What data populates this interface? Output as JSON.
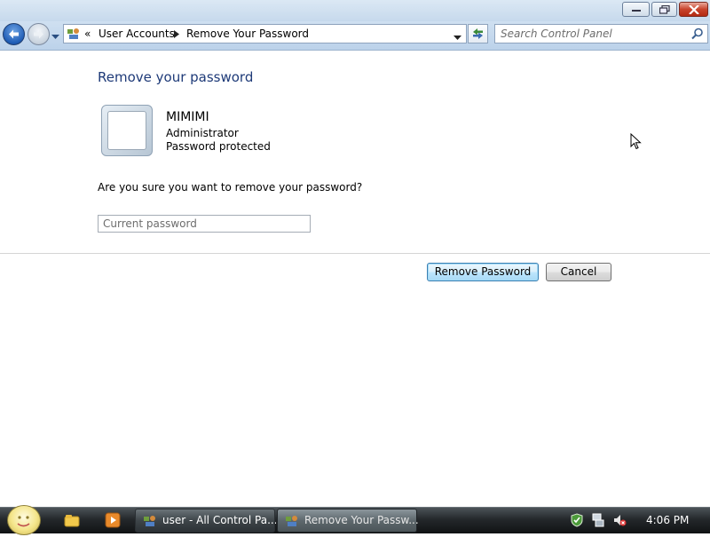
{
  "window": {
    "buttons": {
      "minimize": "minimize",
      "maximize": "maximize",
      "close": "close"
    }
  },
  "navbar": {
    "breadcrumb": [
      {
        "label": "«"
      },
      {
        "label": "User Accounts"
      },
      {
        "label": "Remove Your Password"
      }
    ],
    "search_placeholder": "Search Control Panel"
  },
  "main": {
    "title": "Remove your password",
    "user": {
      "name": "MIMIMI",
      "role": "Administrator",
      "status": "Password protected"
    },
    "question": "Are you sure you want to remove your password?",
    "password_placeholder": "Current password",
    "remove_button": "Remove Password",
    "cancel_button": "Cancel"
  },
  "taskbar": {
    "tasks": [
      {
        "label": "user - All Control Pa...",
        "icon": "control-panel-icon",
        "active": false
      },
      {
        "label": "Remove Your Passw...",
        "icon": "user-accounts-icon",
        "active": true
      }
    ],
    "clock": "4:06 PM"
  },
  "colors": {
    "title_text": "#1e3a78",
    "taskbar": "#24282b",
    "primary_button_border": "#3c7fb1"
  }
}
